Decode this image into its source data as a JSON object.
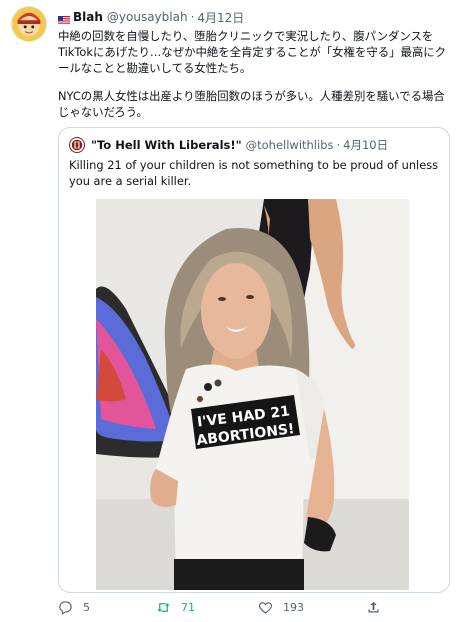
{
  "tweet": {
    "author_name": "Blah",
    "author_handle": "@yousayblah",
    "separator": "·",
    "date": "4月12日",
    "paragraphs": [
      "中絶の回数を自慢したり、堕胎クリニックで実況したり、腹パンダンスをTikTokにあげたり…なぜか中絶を全肯定することが「女権を守る」最高にクールなことと勘違いしてる女性たち。",
      "NYCの黒人女性は出産より堕胎回数のほうが多い。人種差別を騒いでる場合じゃないだろう。"
    ]
  },
  "quoted": {
    "author_name": "\"To Hell With Liberals!\"",
    "author_handle": "@tohellwithlibs",
    "separator": "·",
    "date": "4月10日",
    "text": "Killing 21 of your children is not something to be proud of unless you are a serial killer.",
    "photo_shirt_text_1": "I'VE HAD 21",
    "photo_shirt_text_2": "ABORTIONS!"
  },
  "actions": {
    "reply_count": "5",
    "retweet_count": "71",
    "like_count": "193"
  },
  "icons": {
    "reply": "reply-icon",
    "retweet": "retweet-icon",
    "like": "heart-icon",
    "share": "share-icon",
    "flag": "us-flag-icon"
  },
  "colors": {
    "text": "#0f1419",
    "muted": "#536471",
    "border": "#cfd9de",
    "retweet_active": "#00ba7c"
  }
}
